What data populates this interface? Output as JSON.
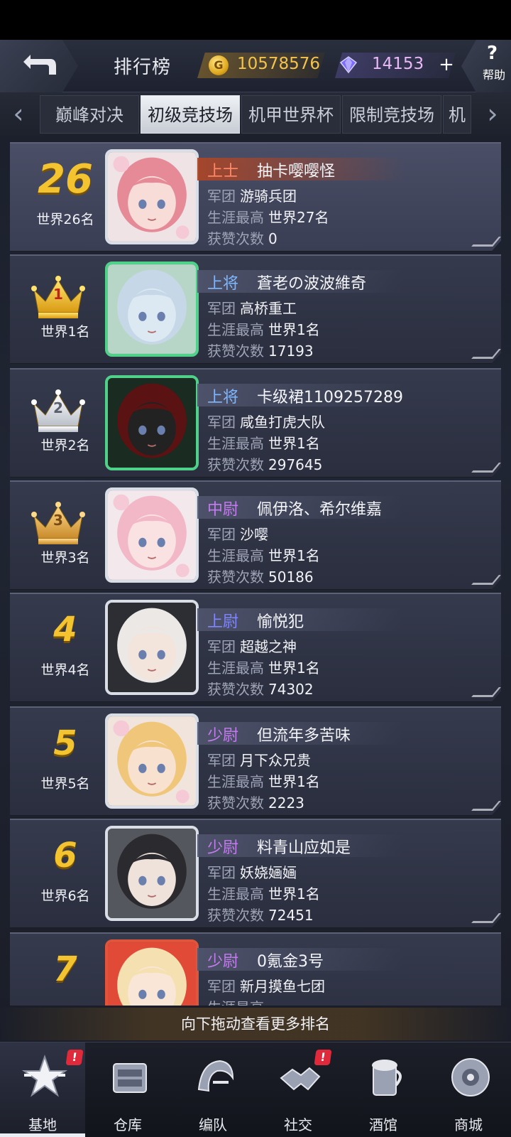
{
  "header": {
    "title": "排行榜",
    "gold": "10578576",
    "gems": "14153",
    "gem_plus": "+",
    "help_q": "?",
    "help_label": "帮助"
  },
  "tabs": [
    {
      "label": "巅峰对决",
      "active": false
    },
    {
      "label": "初级竞技场",
      "active": true
    },
    {
      "label": "机甲世界杯",
      "active": false
    },
    {
      "label": "限制竞技场",
      "active": false
    },
    {
      "label": "机",
      "active": false
    }
  ],
  "labels": {
    "legion": "军团",
    "career_best": "生涯最高",
    "likes": "获赞次数"
  },
  "entries": [
    {
      "rank": "26",
      "world_rank": "世界26名",
      "title": "上士",
      "title_color": "#ff8a6a",
      "name": "抽卡嘤嘤怪",
      "legion": "游骑兵团",
      "career_best": "世界27名",
      "likes": "0",
      "is_me": true
    },
    {
      "rank": "1",
      "world_rank": "世界1名",
      "title": "上将",
      "title_color": "#7fb7ff",
      "name": "蒼老の波波維奇",
      "legion": "高桥重工",
      "career_best": "世界1名",
      "likes": "17193",
      "crown": "gold"
    },
    {
      "rank": "2",
      "world_rank": "世界2名",
      "title": "上将",
      "title_color": "#7fb7ff",
      "name": "卡级裙1109257289",
      "legion": "咸鱼打虎大队",
      "career_best": "世界1名",
      "likes": "297645",
      "crown": "silver"
    },
    {
      "rank": "3",
      "world_rank": "世界3名",
      "title": "中尉",
      "title_color": "#c57bf0",
      "name": "佩伊洛、希尔维嘉",
      "legion": "沙嘤",
      "career_best": "世界1名",
      "likes": "50186",
      "crown": "bronze"
    },
    {
      "rank": "4",
      "world_rank": "世界4名",
      "title": "上尉",
      "title_color": "#7f86ff",
      "name": "愉悦犯",
      "legion": "超越之神",
      "career_best": "世界1名",
      "likes": "74302"
    },
    {
      "rank": "5",
      "world_rank": "世界5名",
      "title": "少尉",
      "title_color": "#c57bf0",
      "name": "但流年多苦味",
      "legion": "月下众兄贵",
      "career_best": "世界1名",
      "likes": "2223"
    },
    {
      "rank": "6",
      "world_rank": "世界6名",
      "title": "少尉",
      "title_color": "#c57bf0",
      "name": "料青山应如是",
      "legion": "妖娆婳婳",
      "career_best": "世界1名",
      "likes": "72451"
    },
    {
      "rank": "7",
      "world_rank": "",
      "title": "少尉",
      "title_color": "#c57bf0",
      "name": "0氪金3号",
      "legion": "新月摸鱼七团",
      "career_best": "",
      "likes": ""
    }
  ],
  "drag_hint": "向下拖动查看更多排名",
  "nav": [
    {
      "label": "基地",
      "badge": "!",
      "active": true
    },
    {
      "label": "仓库"
    },
    {
      "label": "编队"
    },
    {
      "label": "社交",
      "badge": "!"
    },
    {
      "label": "酒馆"
    },
    {
      "label": "商城"
    }
  ],
  "colors": {
    "accent_gold": "#f4c430",
    "badge_red": "#e0293b"
  }
}
